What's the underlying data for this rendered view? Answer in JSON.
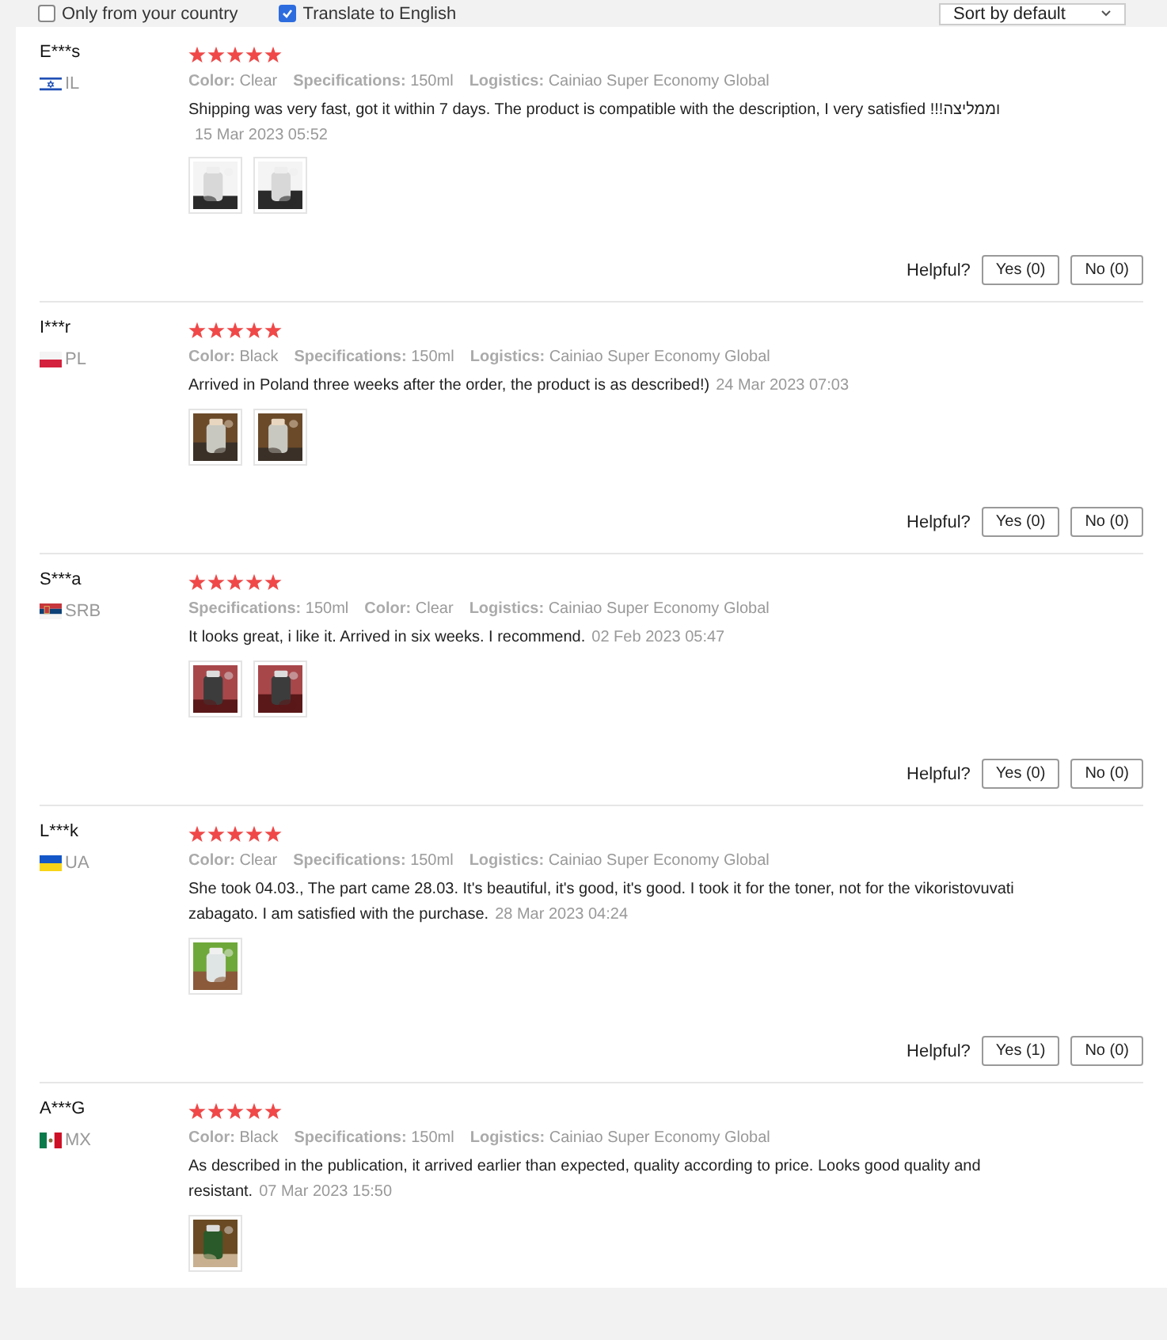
{
  "filters": {
    "options": [
      {
        "label": "Only from your country",
        "checked": false
      },
      {
        "label": "Translate to English",
        "checked": true
      }
    ],
    "sort": {
      "value": "Sort by default"
    }
  },
  "reviews": [
    {
      "name": "E***s",
      "flag": {
        "kind": "il"
      },
      "country": "IL",
      "stars": 5,
      "attributes": [
        {
          "label": "Color:",
          "value": "Clear"
        },
        {
          "label": "Specifications:",
          "value": "150ml"
        },
        {
          "label": "Logistics:",
          "value": "Cainiao Super Economy Global"
        }
      ],
      "text": "Shipping was very fast, got it within 7 days. The product is compatible with the description, I very satisfied !!!וממליצה",
      "date": "15 Mar 2023 05:52",
      "date_on_new_line": true,
      "photos": [
        {
          "kind": "picture"
        },
        {
          "kind": "picture"
        }
      ],
      "helpful": {
        "label": "Helpful?",
        "yes": "Yes (0)",
        "no": "No (0)"
      }
    },
    {
      "name": "I***r",
      "flag": {
        "kind": "pl"
      },
      "country": "PL",
      "stars": 5,
      "attributes": [
        {
          "label": "Color:",
          "value": "Black"
        },
        {
          "label": "Specifications:",
          "value": "150ml"
        },
        {
          "label": "Logistics:",
          "value": "Cainiao Super Economy Global"
        }
      ],
      "text": "Arrived in Poland three weeks after the order, the product is as described!)",
      "date": "24 Mar 2023 07:03",
      "date_on_new_line": false,
      "photos": [
        {
          "kind": "picture"
        },
        {
          "kind": "picture"
        }
      ],
      "helpful": {
        "label": "Helpful?",
        "yes": "Yes (0)",
        "no": "No (0)"
      }
    },
    {
      "name": "S***a",
      "flag": {
        "kind": "srb"
      },
      "country": "SRB",
      "stars": 5,
      "attributes": [
        {
          "label": "Specifications:",
          "value": "150ml"
        },
        {
          "label": "Color:",
          "value": "Clear"
        },
        {
          "label": "Logistics:",
          "value": "Cainiao Super Economy Global"
        }
      ],
      "text": "It looks great, i like it. Arrived in six weeks. I recommend.",
      "date": "02 Feb 2023 05:47",
      "date_on_new_line": false,
      "photos": [
        {
          "kind": "picture"
        },
        {
          "kind": "picture"
        }
      ],
      "helpful": {
        "label": "Helpful?",
        "yes": "Yes (0)",
        "no": "No (0)"
      }
    },
    {
      "name": "L***k",
      "flag": {
        "kind": "ua"
      },
      "country": "UA",
      "stars": 5,
      "attributes": [
        {
          "label": "Color:",
          "value": "Clear"
        },
        {
          "label": "Specifications:",
          "value": "150ml"
        },
        {
          "label": "Logistics:",
          "value": "Cainiao Super Economy Global"
        }
      ],
      "text": "She took 04.03., The part came 28.03. It's beautiful, it's good, it's good. I took it for the toner, not for the vikoristovuvati zabagato. I am satisfied with the purchase.",
      "date": "28 Mar 2023 04:24",
      "date_on_new_line": false,
      "photos": [
        {
          "kind": "picture"
        }
      ],
      "helpful": {
        "label": "Helpful?",
        "yes": "Yes (1)",
        "no": "No (0)"
      }
    },
    {
      "name": "A***G",
      "flag": {
        "kind": "mx"
      },
      "country": "MX",
      "stars": 5,
      "attributes": [
        {
          "label": "Color:",
          "value": "Black"
        },
        {
          "label": "Specifications:",
          "value": "150ml"
        },
        {
          "label": "Logistics:",
          "value": "Cainiao Super Economy Global"
        }
      ],
      "text": "As described in the publication, it arrived earlier than expected, quality according to price. Looks good quality and resistant.",
      "date": "07 Mar 2023 15:50",
      "date_on_new_line": false,
      "photos": [
        {
          "kind": "picture"
        }
      ]
    }
  ]
}
